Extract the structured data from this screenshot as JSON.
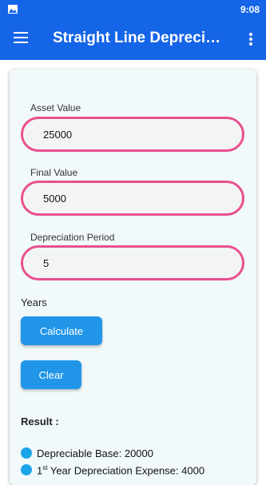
{
  "status_bar": {
    "time": "9:08",
    "image_icon": "image-icon"
  },
  "app_bar": {
    "title": "Straight Line Depreciati…",
    "menu_icon": "hamburger-menu-icon",
    "more_icon": "more-vert-icon"
  },
  "form": {
    "asset_value": {
      "label": "Asset Value",
      "value": "25000"
    },
    "final_value": {
      "label": "Final Value",
      "value": "5000"
    },
    "period": {
      "label": "Depreciation Period",
      "value": "5"
    },
    "period_unit": "Years",
    "field_border_color": "#e8508f"
  },
  "buttons": {
    "calculate": "Calculate",
    "clear": "Clear",
    "color": "#2196e9"
  },
  "result": {
    "label": "Result :",
    "depreciable_base": "Depreciable Base: 20000",
    "first_year_prefix": "1",
    "first_year_sup": "st",
    "first_year_rest": " Year Depreciation Expense: 4000"
  },
  "colors": {
    "accent": "#1565e8",
    "card_bg": "#f1f9fb",
    "bullet": "#1aa5ea"
  }
}
